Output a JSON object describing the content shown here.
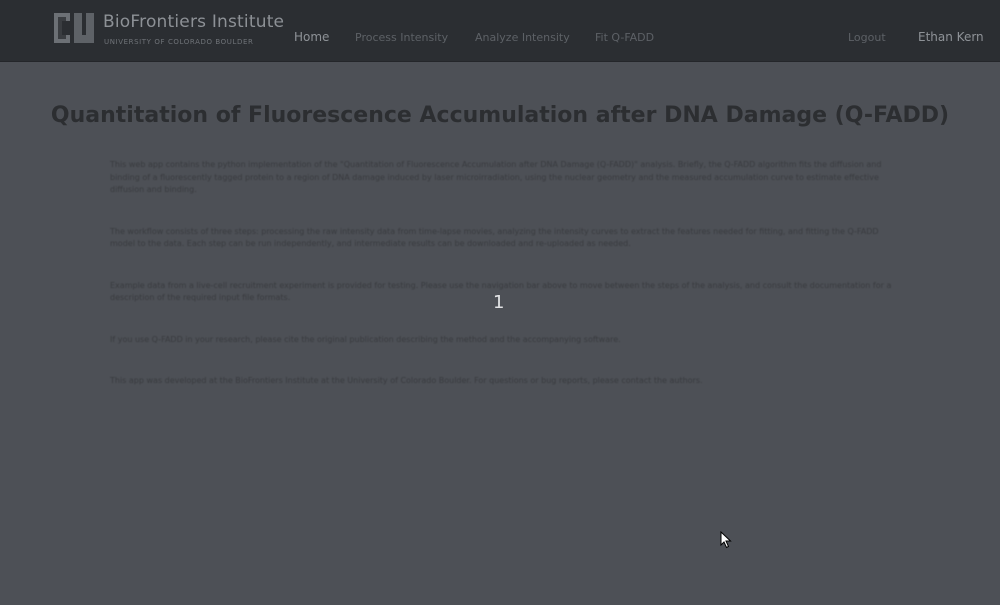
{
  "navbar": {
    "brand_title": "BioFrontiers Institute",
    "brand_subtitle": "UNIVERSITY OF COLORADO BOULDER",
    "items": [
      {
        "label": "Home"
      },
      {
        "label": "Process Intensity"
      },
      {
        "label": "Analyze Intensity"
      },
      {
        "label": "Fit Q-FADD"
      }
    ],
    "logout_label": "Logout",
    "user_name": "Ethan Kern"
  },
  "page": {
    "title": "Quantitation of Fluorescence Accumulation after DNA Damage (Q-FADD)"
  },
  "content": {
    "paragraphs": [
      "This web app contains the python implementation of the \"Quantitation of Fluorescence Accumulation after DNA Damage (Q-FADD)\" analysis. Briefly, the Q-FADD algorithm fits the diffusion and binding of a fluorescently tagged protein to a region of DNA damage induced by laser microirradiation, using the nuclear geometry and the measured accumulation curve to estimate effective diffusion and binding.",
      "The workflow consists of three steps: processing the raw intensity data from time-lapse movies, analyzing the intensity curves to extract the features needed for fitting, and fitting the Q-FADD model to the data. Each step can be run independently, and intermediate results can be downloaded and re-uploaded as needed.",
      "Example data from a live-cell recruitment experiment is provided for testing. Please use the navigation bar above to move between the steps of the analysis, and consult the documentation for a description of the required input file formats.",
      "If you use Q-FADD in your research, please cite the original publication describing the method and the accompanying software.",
      "This app was developed at the BioFrontiers Institute at the University of Colorado Boulder. For questions or bug reports, please contact the authors."
    ]
  },
  "overlay": {
    "frame_number": "1"
  },
  "colors": {
    "navbar_bg": "#2b2e32",
    "page_bg": "#4d5056",
    "title_color": "#2c2e31"
  }
}
